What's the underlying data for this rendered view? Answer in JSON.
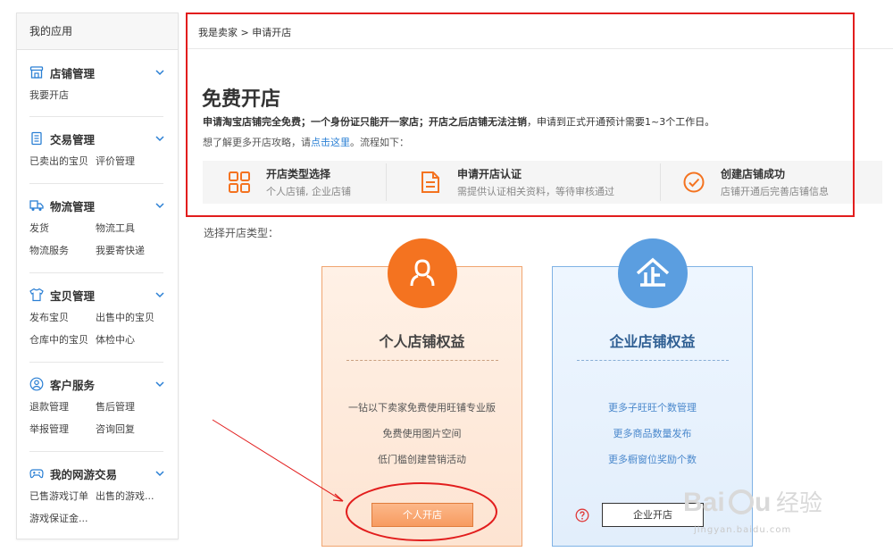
{
  "sidebar": {
    "header": "我的应用",
    "sections": [
      {
        "title": "店铺管理",
        "icon": "shop-icon",
        "links": [
          "我要开店"
        ]
      },
      {
        "title": "交易管理",
        "icon": "order-icon",
        "links": [
          "已卖出的宝贝",
          "评价管理"
        ]
      },
      {
        "title": "物流管理",
        "icon": "truck-icon",
        "links": [
          "发货",
          "物流工具",
          "物流服务",
          "我要寄快递"
        ]
      },
      {
        "title": "宝贝管理",
        "icon": "shirt-icon",
        "links": [
          "发布宝贝",
          "出售中的宝贝",
          "仓库中的宝贝",
          "体检中心"
        ]
      },
      {
        "title": "客户服务",
        "icon": "customer-icon",
        "links": [
          "退款管理",
          "售后管理",
          "举报管理",
          "咨询回复"
        ]
      },
      {
        "title": "我的网游交易",
        "icon": "gamepad-icon",
        "links": [
          "已售游戏订单",
          "出售的游戏...",
          "游戏保证金..."
        ]
      }
    ]
  },
  "breadcrumb": "我是卖家 > 申请开店",
  "page_title": "免费开店",
  "notice": {
    "line1_bold": "申请淘宝店铺完全免费；一个身份证只能开一家店；开店之后店铺无法注销",
    "line1_rest": "，申请到正式开通预计需要1~3个工作日。",
    "line2_prefix": "想了解更多开店攻略，请",
    "line2_link": "点击这里",
    "line2_suffix": "。流程如下："
  },
  "steps": [
    {
      "title": "开店类型选择",
      "desc": "个人店铺, 企业店铺",
      "icon": "grid-icon"
    },
    {
      "title": "申请开店认证",
      "desc": "需提供认证相关资料，等待审核通过",
      "icon": "document-icon"
    },
    {
      "title": "创建店铺成功",
      "desc": "店铺开通后完善店铺信息",
      "icon": "check-circle-icon"
    }
  ],
  "select_label": "选择开店类型：",
  "cards": {
    "personal": {
      "title": "个人店铺权益",
      "benefits": [
        "一钻以下卖家免费使用旺铺专业版",
        "免费使用图片空间",
        "低门槛创建营销活动"
      ],
      "button": "个人开店",
      "icon": "person-icon"
    },
    "enterprise": {
      "title": "企业店铺权益",
      "benefits": [
        "更多子旺旺个数管理",
        "更多商品数量发布",
        "更多橱窗位奖励个数"
      ],
      "button": "企业开店",
      "icon": "enterprise-icon"
    }
  },
  "watermark": {
    "brand": "Baidu经验",
    "url": "jingyan.baidu.com"
  },
  "colors": {
    "accent_orange": "#f47320",
    "accent_blue": "#5b9ee0",
    "annotation_red": "#e21d1d",
    "link": "#2a7fd4"
  }
}
